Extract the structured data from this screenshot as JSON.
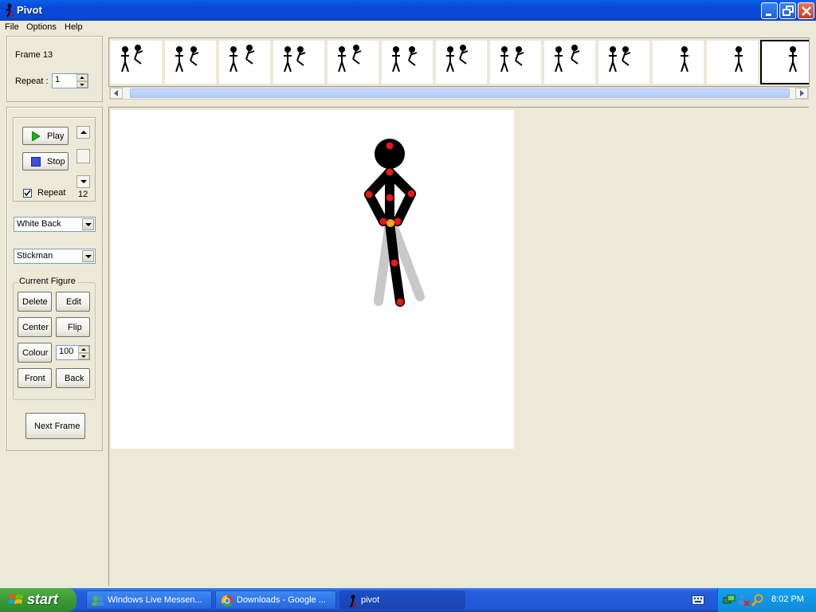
{
  "window": {
    "title": "Pivot",
    "icon": "stickman-icon"
  },
  "title_buttons": {
    "minimize": "minimize-icon",
    "restore": "restore-icon",
    "close": "close-icon"
  },
  "menu": [
    "File",
    "Options",
    "Help"
  ],
  "frame_panel": {
    "frame_label": "Frame 13",
    "repeat_label": "Repeat :",
    "repeat_value": "1"
  },
  "playback": {
    "play": "Play",
    "stop": "Stop",
    "repeat_label": "Repeat",
    "repeat_checked": true,
    "speed_value": "12"
  },
  "backgrounds": {
    "selected": "White Back"
  },
  "figure_type": {
    "selected": "Stickman"
  },
  "current_figure": {
    "legend": "Current Figure",
    "delete": "Delete",
    "edit": "Edit",
    "center": "Center",
    "flip": "Flip",
    "colour": "Colour",
    "colour_value": "100",
    "front": "Front",
    "back": "Back"
  },
  "next_frame": "Next Frame",
  "timeline": {
    "frame_count": 13,
    "selected_frame": 13
  },
  "colors": {
    "handle_red": "#e41a1a",
    "handle_orange": "#f5a623",
    "onion_gray": "#c8c8c8"
  },
  "taskbar": {
    "start": "start",
    "tasks": [
      "Windows Live Messen...",
      "Downloads - Google ...",
      "pivot"
    ],
    "clock": "8:02 PM"
  }
}
